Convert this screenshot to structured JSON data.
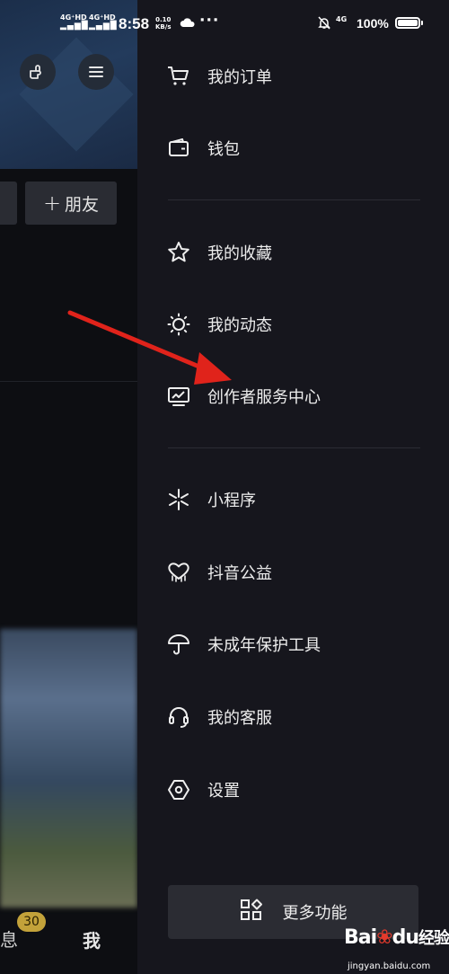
{
  "status_bar": {
    "sim1": "4G⁺HD",
    "sim2": "4G⁺HD",
    "time": "8:58",
    "net_speed_value": "0.10",
    "net_speed_unit": "KB/s",
    "more": "···",
    "network": "4G",
    "battery": "100%"
  },
  "background_page": {
    "add_friend_label": "朋友",
    "add_friend_plus": "+",
    "tab_messages": "息",
    "messages_badge": "30",
    "tab_me": "我"
  },
  "drawer": {
    "group1": [
      {
        "label": "我的订单",
        "icon": "cart-icon"
      },
      {
        "label": "钱包",
        "icon": "wallet-icon"
      }
    ],
    "group2": [
      {
        "label": "我的收藏",
        "icon": "star-icon"
      },
      {
        "label": "我的动态",
        "icon": "sun-icon"
      },
      {
        "label": "创作者服务中心",
        "icon": "chart-monitor-icon"
      }
    ],
    "group3": [
      {
        "label": "小程序",
        "icon": "asterisk-icon"
      },
      {
        "label": "抖音公益",
        "icon": "heart-rain-icon"
      },
      {
        "label": "未成年保护工具",
        "icon": "umbrella-icon"
      },
      {
        "label": "我的客服",
        "icon": "headset-icon"
      },
      {
        "label": "设置",
        "icon": "hexagon-gear-icon"
      }
    ],
    "more_button": "更多功能"
  },
  "watermark": {
    "brand": "Bai",
    "brand_paw": "du",
    "brand_cn": "经验",
    "url": "jingyan.baidu.com"
  },
  "colors": {
    "drawer_bg": "#16161d",
    "accent_red": "#e0231b",
    "badge": "#c3a23a"
  }
}
